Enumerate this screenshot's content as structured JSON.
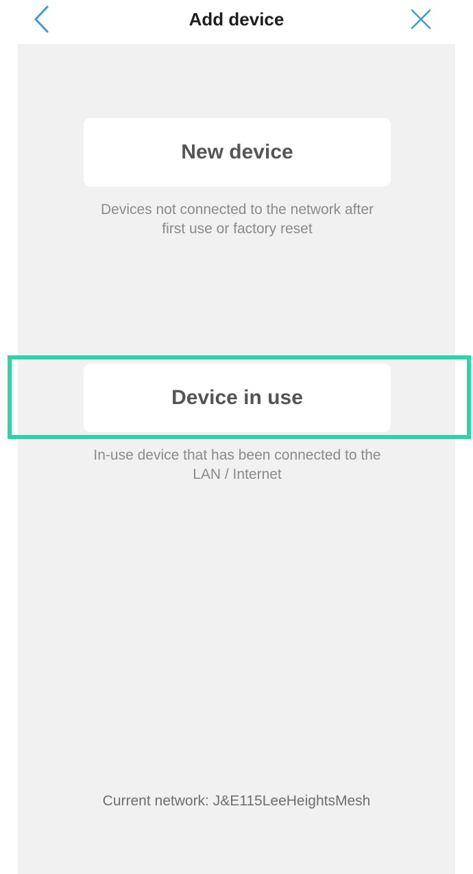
{
  "header": {
    "title": "Add device",
    "back_icon": "chevron-left-icon",
    "close_icon": "close-icon",
    "icon_color": "#3a9bd9"
  },
  "options": {
    "new_device": {
      "label": "New device",
      "description_line1": "Devices not connected to the network after",
      "description_line2": "first use or factory reset"
    },
    "device_in_use": {
      "label": "Device in use",
      "description_line1": "In-use device that has been connected to the",
      "description_line2": "LAN / Internet",
      "highlighted": true,
      "highlight_color": "#2ed3a8"
    }
  },
  "footer": {
    "current_network": "Current network: J&E115LeeHeightsMesh"
  }
}
